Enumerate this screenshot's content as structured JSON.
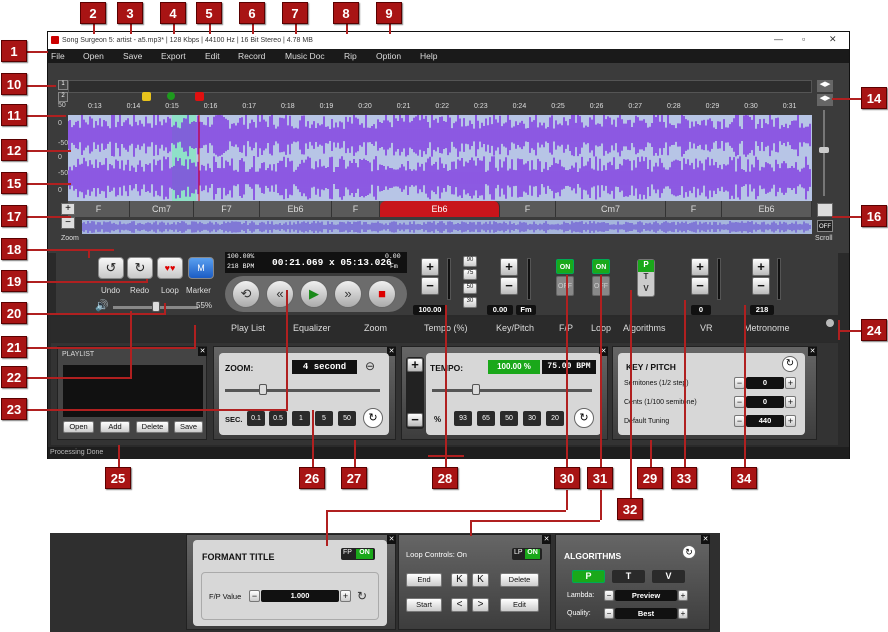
{
  "window": {
    "title": "Song Surgeon 5: artist - a5.mp3* | 128 Kbps | 44100 Hz | 16 Bit Stereo | 4.78 MB",
    "status": "Processing Done"
  },
  "menu": [
    "File",
    "Open",
    "Save",
    "Export",
    "Edit",
    "Record",
    "Music Doc",
    "Rip",
    "Option",
    "Help"
  ],
  "ruler": [
    "0:13",
    "0:14",
    "0:15",
    "0:16",
    "0:17",
    "0:18",
    "0:19",
    "0:20",
    "0:21",
    "0:22",
    "0:23",
    "0:24",
    "0:25",
    "0:26",
    "0:27",
    "0:28",
    "0:29",
    "0:30",
    "0:31"
  ],
  "db_labels": [
    "50",
    "0",
    "-50",
    "0",
    "-50",
    "0"
  ],
  "chords": [
    "F",
    "Cm7",
    "F7",
    "Eb6",
    "F",
    "Eb6",
    "F",
    "Cm7",
    "F",
    "Eb6"
  ],
  "zoom_label": "Zoom",
  "scroll_label": "Scroll",
  "off_label": "OFF",
  "transport": {
    "undo": "Undo",
    "redo": "Redo",
    "loop": "Loop",
    "marker": "Marker",
    "volume": "55%",
    "tempo_pct": "100.00%",
    "bpm": "218 BPM",
    "time": "00:21.069 x 05:13.026",
    "key_val": "0.00",
    "key_name": "Fm"
  },
  "values": {
    "tempo": "100.00",
    "keypitch": "0.00",
    "key_fm": "Fm",
    "vr": "0",
    "metronome": "218"
  },
  "tempo_presets": [
    "90",
    "75",
    "50",
    "30"
  ],
  "tabs": [
    "Play List",
    "Equalizer",
    "Zoom",
    "Tempo (%)",
    "Key/Pitch",
    "F/P",
    "Loop",
    "Algorithms",
    "VR",
    "Metronome"
  ],
  "on": "ON",
  "off": "OFF",
  "playlist": {
    "title": "PLAYLIST",
    "buttons": [
      "Open",
      "Add",
      "Delete",
      "Save"
    ]
  },
  "zoom": {
    "label": "ZOOM:",
    "value": "4 second",
    "sec": "SEC.",
    "buttons": [
      "0.1",
      "0.5",
      "1",
      "5",
      "50"
    ]
  },
  "tempo": {
    "label": "TEMPO:",
    "pct": "100.00 %",
    "bpm": "75.00 BPM",
    "percent": "%",
    "buttons": [
      "93",
      "65",
      "50",
      "30",
      "20"
    ]
  },
  "keypitch": {
    "title": "KEY / PITCH",
    "rows": [
      {
        "label": "Semitones (1/2 step)",
        "value": "0"
      },
      {
        "label": "Cents (1/100 semitone)",
        "value": "0"
      },
      {
        "label": "Default Tuning",
        "value": "440"
      }
    ]
  },
  "formant": {
    "title": "FORMANT TITLE",
    "fp": "FP",
    "on": "ON",
    "fp_value_label": "F/P Value",
    "fp_value": "1.000"
  },
  "loopctl": {
    "title": "Loop Controls: On",
    "lp": "LP",
    "on": "ON",
    "end": "End",
    "start": "Start",
    "delete": "Delete",
    "edit": "Edit"
  },
  "algorithms": {
    "title": "ALGORITHMS",
    "buttons": [
      "P",
      "T",
      "V"
    ],
    "lambda_label": "Lambda:",
    "lambda": "Preview",
    "quality_label": "Quality:",
    "quality": "Best"
  },
  "badges": [
    "1",
    "2",
    "3",
    "4",
    "5",
    "6",
    "7",
    "8",
    "9",
    "10",
    "11",
    "12",
    "14",
    "15",
    "16",
    "17",
    "18",
    "19",
    "20",
    "21",
    "22",
    "23",
    "24",
    "25",
    "26",
    "27",
    "28",
    "29",
    "30",
    "31",
    "32",
    "33",
    "34"
  ],
  "ptv": [
    "P",
    "T",
    "V"
  ]
}
